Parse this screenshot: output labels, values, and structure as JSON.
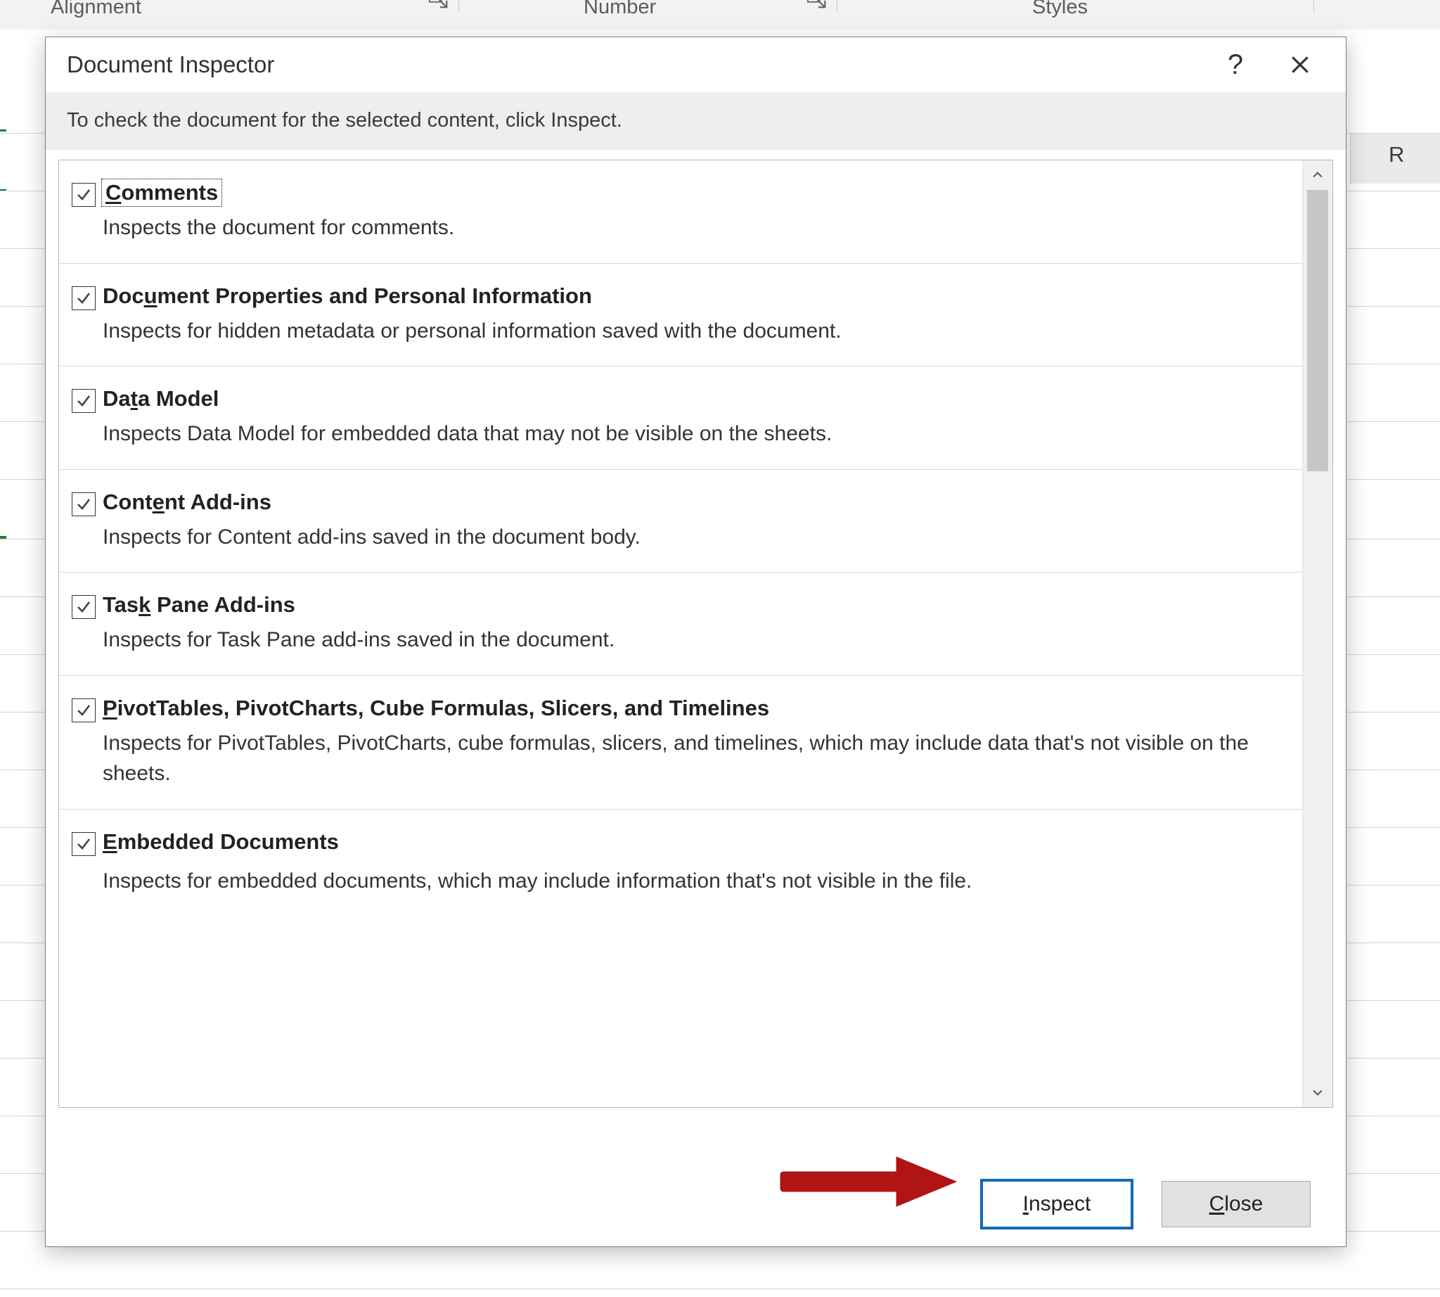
{
  "ribbon": {
    "groups": {
      "alignment": "Alignment",
      "number": "Number",
      "styles": "Styles"
    }
  },
  "sheet": {
    "column_r": "R"
  },
  "dialog": {
    "title": "Document Inspector",
    "instruction": "To check the document for the selected content, click Inspect.",
    "buttons": {
      "inspect": "Inspect",
      "close": "Close"
    },
    "items": [
      {
        "title": "Comments",
        "desc": "Inspects the document for comments."
      },
      {
        "title": "Document Properties and Personal Information",
        "desc": "Inspects for hidden metadata or personal information saved with the document."
      },
      {
        "title": "Data Model",
        "desc": "Inspects Data Model for embedded data that may not be visible on the sheets."
      },
      {
        "title": "Content Add-ins",
        "desc": "Inspects for Content add-ins saved in the document body."
      },
      {
        "title": "Task Pane Add-ins",
        "desc": "Inspects for Task Pane add-ins saved in the document."
      },
      {
        "title": "PivotTables, PivotCharts, Cube Formulas, Slicers, and Timelines",
        "desc": "Inspects for PivotTables, PivotCharts, cube formulas, slicers, and timelines, which may include data that's not visible on the sheets."
      },
      {
        "title": "Embedded Documents",
        "desc": "Inspects for embedded documents, which may include information that's not visible in the file."
      }
    ],
    "accelerators": {
      "comments": "C",
      "docprops": "u",
      "datamodel": "t",
      "content": "e",
      "taskpane": "k",
      "pivot": "P",
      "embedded": "E",
      "inspect": "I",
      "close": "C"
    }
  }
}
